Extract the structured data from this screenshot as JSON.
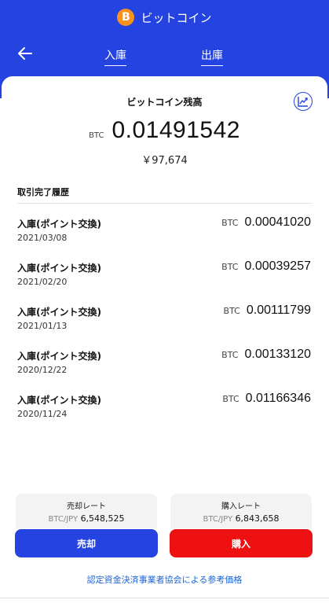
{
  "header": {
    "title": "ビットコイン",
    "logo_symbol": "B",
    "brand_color": "#2543e0",
    "tabs": [
      {
        "label": "入庫"
      },
      {
        "label": "出庫"
      }
    ]
  },
  "balance": {
    "title": "ビットコイン残高",
    "unit": "BTC",
    "amount": "0.01491542",
    "jpy": "￥97,674"
  },
  "history": {
    "heading": "取引完了履歴",
    "items": [
      {
        "label": "入庫(ポイント交換)",
        "date": "2021/03/08",
        "unit": "BTC",
        "amount": "0.00041020"
      },
      {
        "label": "入庫(ポイント交換)",
        "date": "2021/02/20",
        "unit": "BTC",
        "amount": "0.00039257"
      },
      {
        "label": "入庫(ポイント交換)",
        "date": "2021/01/13",
        "unit": "BTC",
        "amount": "0.00111799"
      },
      {
        "label": "入庫(ポイント交換)",
        "date": "2020/12/22",
        "unit": "BTC",
        "amount": "0.00133120"
      },
      {
        "label": "入庫(ポイント交換)",
        "date": "2020/11/24",
        "unit": "BTC",
        "amount": "0.01166346"
      }
    ]
  },
  "rates": {
    "sell": {
      "title": "売却レート",
      "pair": "BTC/JPY",
      "value": "6,548,525"
    },
    "buy": {
      "title": "購入レート",
      "pair": "BTC/JPY",
      "value": "6,843,658"
    }
  },
  "actions": {
    "sell_label": "売却",
    "buy_label": "購入",
    "sell_color": "#2543e0",
    "buy_color": "#ee1111"
  },
  "footer": {
    "reference_link": "認定資金決済事業者協会による参考価格"
  }
}
